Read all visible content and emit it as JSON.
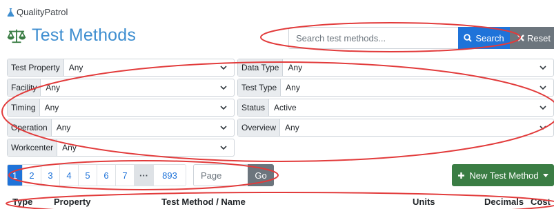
{
  "brand": {
    "name": "QualityPatrol"
  },
  "page": {
    "title": "Test Methods"
  },
  "search": {
    "placeholder": "Search test methods...",
    "search_label": "Search",
    "reset_label": "Reset"
  },
  "filters": {
    "test_property": {
      "label": "Test Property",
      "value": "Any"
    },
    "data_type": {
      "label": "Data Type",
      "value": "Any"
    },
    "facility": {
      "label": "Facility",
      "value": "Any"
    },
    "test_type": {
      "label": "Test Type",
      "value": "Any"
    },
    "timing": {
      "label": "Timing",
      "value": "Any"
    },
    "status": {
      "label": "Status",
      "value": "Active"
    },
    "operation": {
      "label": "Operation",
      "value": "Any"
    },
    "overview": {
      "label": "Overview",
      "value": "Any"
    },
    "workcenter": {
      "label": "Workcenter",
      "value": "Any"
    }
  },
  "pagination": {
    "pages": [
      "1",
      "2",
      "3",
      "4",
      "5",
      "6",
      "7"
    ],
    "ellipsis": "···",
    "last": "893",
    "active_page": 1,
    "page_placeholder": "Page",
    "go_label": "Go"
  },
  "actions": {
    "new_label": "New Test Method"
  },
  "table": {
    "columns": {
      "type": "Type",
      "property": "Property",
      "method": "Test Method / Name",
      "units": "Units",
      "decimals": "Decimals",
      "cost": "Cost"
    }
  },
  "colors": {
    "accent": "#1f73d9",
    "title": "#3e8ed0",
    "success": "#3a7d44",
    "secondary": "#6c757d",
    "annotation": "#e23b3b"
  },
  "icons": {
    "brand": "flask-icon",
    "title": "balance-scale-icon",
    "search": "search-icon",
    "reset": "close-icon",
    "new": "plus-icon",
    "dropdown": "chevron-down-icon"
  }
}
